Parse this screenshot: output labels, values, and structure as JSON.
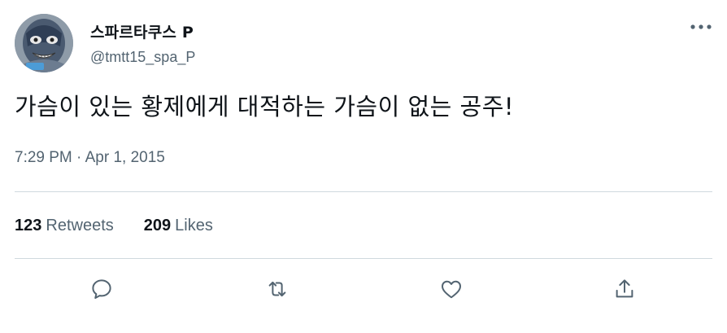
{
  "author": {
    "display_name": "스파르타쿠스 P",
    "handle": "@tmtt15_spa_P",
    "avatar_icon": "masked-man-avatar"
  },
  "menu": {
    "more_icon": "more-horizontal-icon"
  },
  "tweet": {
    "text": "가슴이 있는 황제에게 대적하는 가슴이 없는 공주!",
    "time": "7:29 PM",
    "separator": "·",
    "date": "Apr 1, 2015"
  },
  "stats": {
    "retweets_count": "123",
    "retweets_label": "Retweets",
    "likes_count": "209",
    "likes_label": "Likes"
  },
  "actions": {
    "reply_icon": "reply-icon",
    "retweet_icon": "retweet-icon",
    "like_icon": "heart-icon",
    "share_icon": "share-icon"
  },
  "colors": {
    "text_primary": "#0f1419",
    "text_secondary": "#536471",
    "divider": "#cfd9de"
  }
}
